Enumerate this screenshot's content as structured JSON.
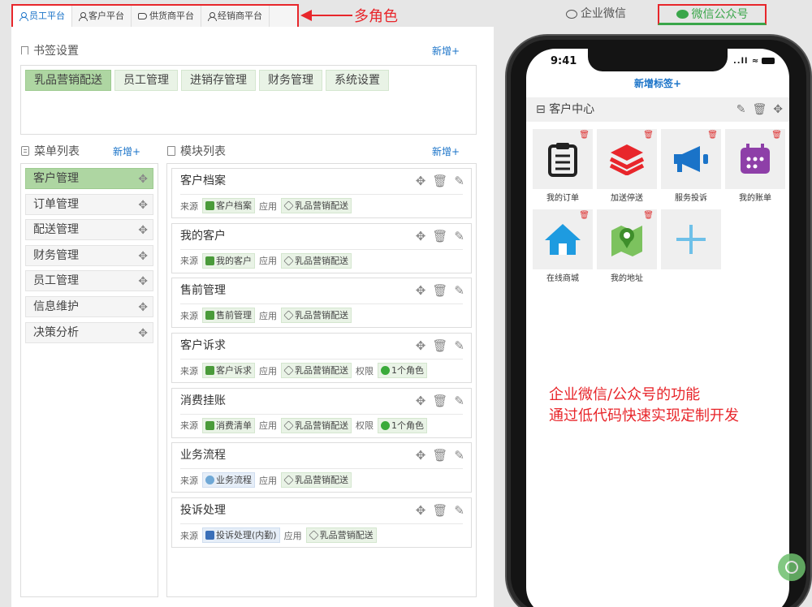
{
  "platform_tabs": [
    {
      "label": "员工平台",
      "active": true
    },
    {
      "label": "客户平台",
      "active": false
    },
    {
      "label": "供货商平台",
      "active": false
    },
    {
      "label": "经销商平台",
      "active": false
    }
  ],
  "annotation_roles": "多角色",
  "bookmarks": {
    "title": "书签设置",
    "add_label": "新增+",
    "items": [
      "乳品营销配送",
      "员工管理",
      "进销存管理",
      "财务管理",
      "系统设置"
    ]
  },
  "menu": {
    "title": "菜单列表",
    "add_label": "新增+",
    "items": [
      "客户管理",
      "订单管理",
      "配送管理",
      "财务管理",
      "员工管理",
      "信息维护",
      "决策分析"
    ]
  },
  "modules": {
    "title": "模块列表",
    "add_label": "新增+",
    "source_label": "来源",
    "app_label": "应用",
    "perm_label": "权限",
    "items": [
      {
        "name": "客户档案",
        "source": "客户档案",
        "app": "乳品营销配送",
        "perm": ""
      },
      {
        "name": "我的客户",
        "source": "我的客户",
        "app": "乳品营销配送",
        "perm": ""
      },
      {
        "name": "售前管理",
        "source": "售前管理",
        "app": "乳品营销配送",
        "perm": ""
      },
      {
        "name": "客户诉求",
        "source": "客户诉求",
        "app": "乳品营销配送",
        "perm": "1个角色"
      },
      {
        "name": "消费挂账",
        "source": "消费清单",
        "app": "乳品营销配送",
        "perm": "1个角色"
      },
      {
        "name": "业务流程",
        "source": "业务流程",
        "app": "乳品营销配送",
        "perm": ""
      },
      {
        "name": "投诉处理",
        "source": "投诉处理(内勤)",
        "app": "乳品营销配送",
        "perm": ""
      }
    ]
  },
  "right_tabs": {
    "work_wechat": "企业微信",
    "wechat_official": "微信公众号"
  },
  "phone": {
    "time": "9:41",
    "signal": "..ll ≈",
    "add_tag": "新增标签+",
    "group_title": "客户中心",
    "grid": [
      {
        "label": "我的订单",
        "icon": "order-list-icon"
      },
      {
        "label": "加送停送",
        "icon": "layers-icon"
      },
      {
        "label": "服务投诉",
        "icon": "megaphone-icon"
      },
      {
        "label": "我的账单",
        "icon": "calendar-bill-icon"
      },
      {
        "label": "在线商城",
        "icon": "home-icon"
      },
      {
        "label": "我的地址",
        "icon": "map-pin-icon"
      },
      {
        "label": "",
        "icon": "plus-icon"
      }
    ]
  },
  "annotation_phone": {
    "line1": "企业微信/公众号的功能",
    "line2": "通过低代码快速实现定制开发"
  },
  "colors": {
    "accent_blue": "#1a73c8",
    "highlight_red": "#e8262b",
    "tag_green": "#aed6a2",
    "wechat_green": "#3aa64a"
  }
}
